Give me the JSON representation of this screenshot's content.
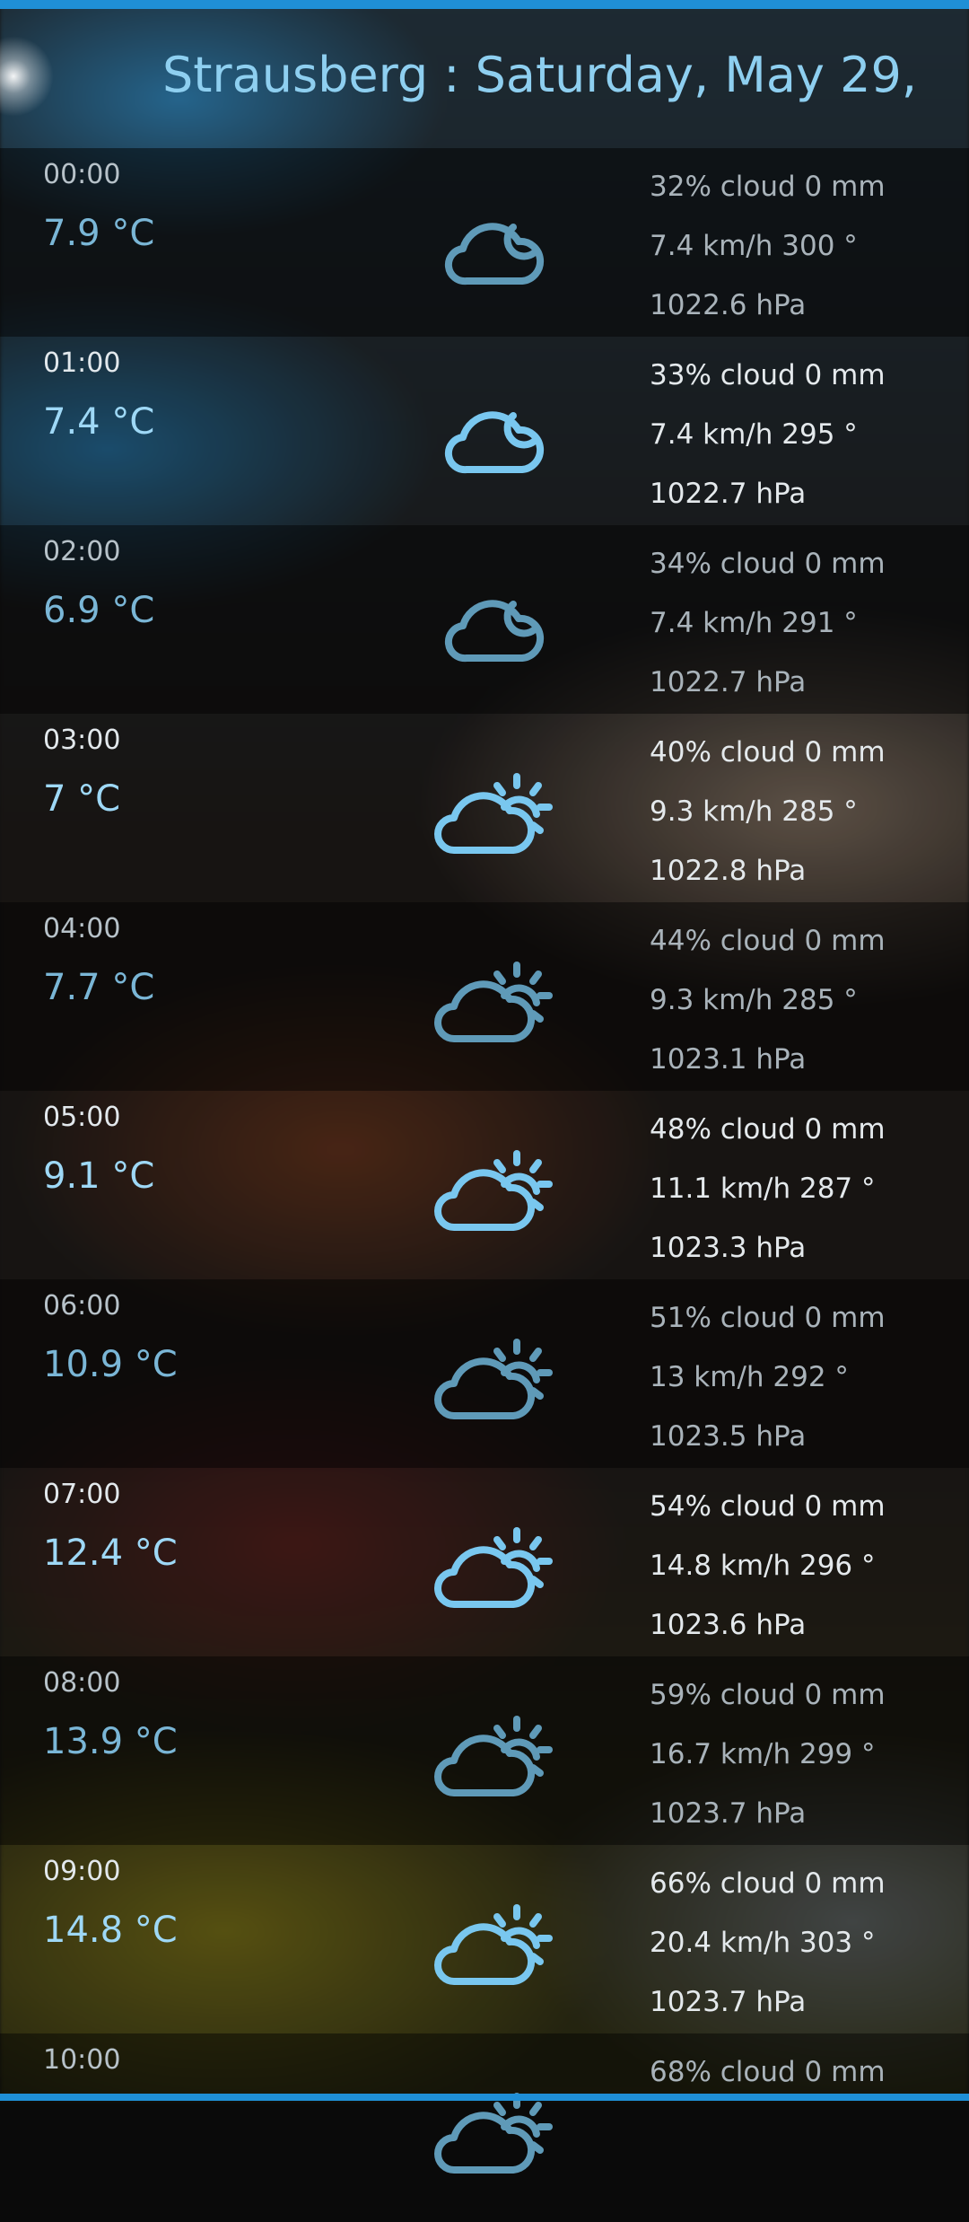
{
  "header": {
    "title": "Strausberg : Saturday, May 29,"
  },
  "colors": {
    "accent": "#1f8fd6",
    "title": "#8ecff0",
    "icon": "#79c7ef"
  },
  "forecast": [
    {
      "time": "00:00",
      "temp": "7.9 °C",
      "icon": "cloud-moon-icon",
      "cloud": "32% cloud  0 mm",
      "wind": "7.4 km/h 300 °",
      "pressure": "1022.6 hPa"
    },
    {
      "time": "01:00",
      "temp": "7.4 °C",
      "icon": "cloud-moon-icon",
      "cloud": "33% cloud  0 mm",
      "wind": "7.4 km/h 295 °",
      "pressure": "1022.7 hPa"
    },
    {
      "time": "02:00",
      "temp": "6.9 °C",
      "icon": "cloud-moon-icon",
      "cloud": "34% cloud  0 mm",
      "wind": "7.4 km/h 291 °",
      "pressure": "1022.7 hPa"
    },
    {
      "time": "03:00",
      "temp": "7 °C",
      "icon": "cloud-sun-icon",
      "cloud": "40% cloud  0 mm",
      "wind": "9.3 km/h 285 °",
      "pressure": "1022.8 hPa"
    },
    {
      "time": "04:00",
      "temp": "7.7 °C",
      "icon": "cloud-sun-icon",
      "cloud": "44% cloud  0 mm",
      "wind": "9.3 km/h 285 °",
      "pressure": "1023.1 hPa"
    },
    {
      "time": "05:00",
      "temp": "9.1 °C",
      "icon": "cloud-sun-icon",
      "cloud": "48% cloud  0 mm",
      "wind": "11.1 km/h 287 °",
      "pressure": "1023.3 hPa"
    },
    {
      "time": "06:00",
      "temp": "10.9 °C",
      "icon": "cloud-sun-icon",
      "cloud": "51% cloud  0 mm",
      "wind": "13 km/h 292 °",
      "pressure": "1023.5 hPa"
    },
    {
      "time": "07:00",
      "temp": "12.4 °C",
      "icon": "cloud-sun-icon",
      "cloud": "54% cloud  0 mm",
      "wind": "14.8 km/h 296 °",
      "pressure": "1023.6 hPa"
    },
    {
      "time": "08:00",
      "temp": "13.9 °C",
      "icon": "cloud-sun-icon",
      "cloud": "59% cloud  0 mm",
      "wind": "16.7 km/h 299 °",
      "pressure": "1023.7 hPa"
    },
    {
      "time": "09:00",
      "temp": "14.8 °C",
      "icon": "cloud-sun-icon",
      "cloud": "66% cloud  0 mm",
      "wind": "20.4 km/h 303 °",
      "pressure": "1023.7 hPa"
    },
    {
      "time": "10:00",
      "temp": "",
      "icon": "cloud-sun-icon",
      "cloud": "68% cloud  0 mm",
      "wind": "",
      "pressure": ""
    }
  ]
}
